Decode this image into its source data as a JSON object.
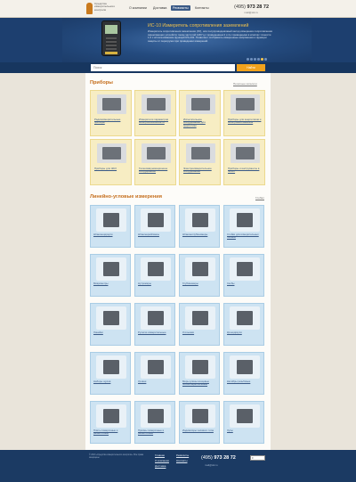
{
  "header": {
    "logo_lines": [
      "Средства",
      "измерительного",
      "контроля"
    ],
    "nav": [
      {
        "label": "О компании",
        "active": false
      },
      {
        "label": "Доставка",
        "active": false
      },
      {
        "label": "Реквизиты",
        "active": true
      },
      {
        "label": "Контакты",
        "active": false
      }
    ],
    "phone_prefix": "(495)",
    "phone_number": "973 28 72",
    "email": "mail@sik.ru"
  },
  "banner": {
    "title": "ИС-10 Измеритель сопротивления заземлений",
    "text": "Измеритель сопротивления заземления (ЗУ), или полупроводниковый метод измерения сопротивления заземляющих устройств током частотой 128 Гц с проведением 2 и 4-х проводными в классах точности 1,5 с использованием функций RS-232. Позволяет отображать измеренные напряжения и функции защиты от перегрузок при проведении измерений.",
    "active_slide": 4,
    "slides": 6
  },
  "search": {
    "placeholder": "Поиск",
    "button_label": "Найти"
  },
  "section1": {
    "title": "Приборы",
    "link": "Печатные каталоги",
    "items": [
      "Радиоизмерительные приборы",
      "Измерители параметров электробезопасности",
      "Испытательное оборудование для энергетики",
      "Приборы для энергетиков и электромонтажников",
      "Приборы для ЖКХ",
      "Телекоммуникационное оборудование",
      "Электроизмерительное оборудование",
      "Приборы и инструменты в ЭСАП"
    ]
  },
  "section2": {
    "title": "Линейно-угловые измерения",
    "link": "Глобал",
    "items": [
      "Штангенциркули",
      "Штангенрейсмасы",
      "Штангенглубиномеры",
      "Стойки для измерительных головок",
      "Микрометры",
      "Нутромеры",
      "Глубиномеры",
      "Скобы",
      "Линейки",
      "Рулетки измерительные",
      "Угольники",
      "Кронциркули",
      "Наборы щупов",
      "Уровни",
      "Меры длины концевые плоскопараллельные",
      "Калибры резьбовые",
      "Плиты поверочные и разметочные",
      "Призмы поверочные и разметочные",
      "Индикаторы часового типа",
      "Лупы"
    ]
  },
  "footer": {
    "copyright": "© 2013 «Средства измерительного контроля». Все права защищены.",
    "nav": [
      "Главная",
      "О компании",
      "Доставка",
      "Реквизиты",
      "Контакты"
    ],
    "phone_prefix": "(495)",
    "phone_number": "973 28 72",
    "email": "mail@sik.ru",
    "counter": "0"
  }
}
